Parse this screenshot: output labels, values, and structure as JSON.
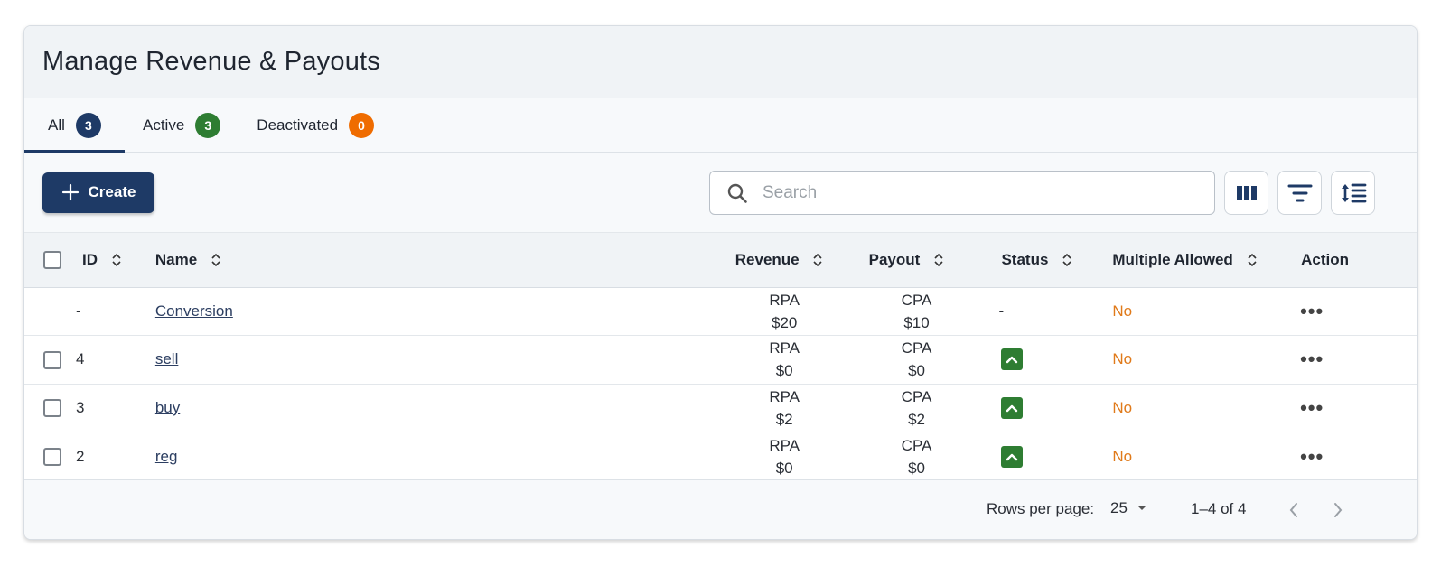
{
  "page": {
    "title": "Manage Revenue & Payouts"
  },
  "tabs": [
    {
      "label": "All",
      "count": "3",
      "color": "#1e3a66"
    },
    {
      "label": "Active",
      "count": "3",
      "color": "#2e7d32"
    },
    {
      "label": "Deactivated",
      "count": "0",
      "color": "#ef6c00"
    }
  ],
  "toolbar": {
    "create_label": "Create",
    "search_placeholder": "Search"
  },
  "table": {
    "headers": {
      "id": "ID",
      "name": "Name",
      "revenue": "Revenue",
      "payout": "Payout",
      "status": "Status",
      "multiple": "Multiple Allowed",
      "action": "Action"
    },
    "rows": [
      {
        "id": "-",
        "name": "Conversion",
        "revenue_type": "RPA",
        "revenue": "$20",
        "payout_type": "CPA",
        "payout": "$10",
        "status": "-",
        "multiple": "No"
      },
      {
        "id": "4",
        "name": "sell",
        "revenue_type": "RPA",
        "revenue": "$0",
        "payout_type": "CPA",
        "payout": "$0",
        "status": "up",
        "multiple": "No"
      },
      {
        "id": "3",
        "name": "buy",
        "revenue_type": "RPA",
        "revenue": "$2",
        "payout_type": "CPA",
        "payout": "$2",
        "status": "up",
        "multiple": "No"
      },
      {
        "id": "2",
        "name": "reg",
        "revenue_type": "RPA",
        "revenue": "$0",
        "payout_type": "CPA",
        "payout": "$0",
        "status": "up",
        "multiple": "No"
      }
    ]
  },
  "pagination": {
    "rows_per_page_label": "Rows per page:",
    "rows_per_page": "25",
    "range": "1–4 of 4"
  },
  "colors": {
    "primary": "#1e3a66",
    "success": "#2e7d32",
    "warning": "#ef6c00",
    "no_text": "#e07a1a"
  },
  "icons": [
    "plus-icon",
    "search-icon",
    "columns-icon",
    "filter-icon",
    "density-icon",
    "sort-icon",
    "chevron-up-icon",
    "more-horizontal-icon",
    "caret-down-icon",
    "chevron-left-icon",
    "chevron-right-icon"
  ]
}
